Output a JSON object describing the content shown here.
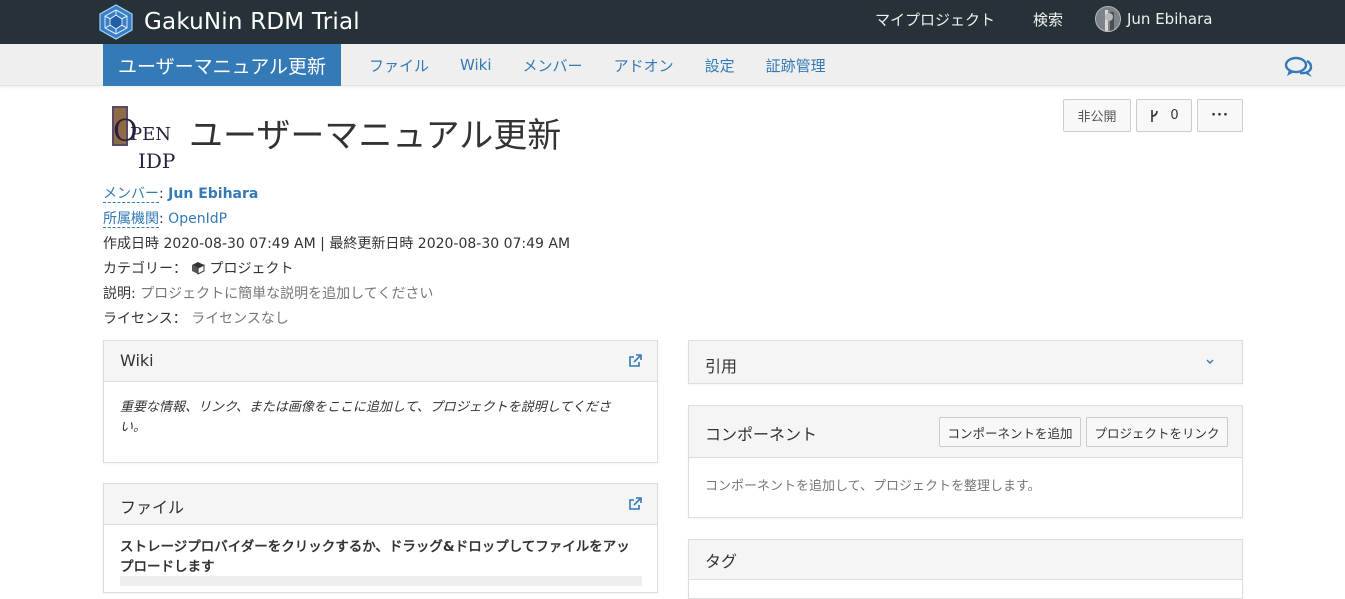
{
  "topbar": {
    "brand": "GakuNin RDM Trial",
    "my_projects": "マイプロジェクト",
    "search": "検索",
    "user_name": "Jun Ebihara"
  },
  "project_nav": {
    "title": "ユーザーマニュアル更新",
    "tabs": [
      "ファイル",
      "Wiki",
      "メンバー",
      "アドオン",
      "設定",
      "証跡管理"
    ]
  },
  "header": {
    "logo_line1": "OPEN",
    "logo_line2": "IDP",
    "title": "ユーザーマニュアル更新",
    "private_label": "非公開",
    "fork_count": "0",
    "more_label": "···"
  },
  "meta": {
    "members_label": "メンバー",
    "members_value": "Jun Ebihara",
    "affiliation_label": "所属機関",
    "affiliation_value": "OpenIdP",
    "dates": "作成日時 2020-08-30 07:49 AM | 最終更新日時 2020-08-30 07:49 AM",
    "category_label": "カテゴリー：",
    "category_value": "プロジェクト",
    "description_label": "説明:",
    "description_value": "プロジェクトに簡単な説明を追加してください",
    "license_label": "ライセンス：",
    "license_value": "ライセンスなし"
  },
  "wiki_panel": {
    "title": "Wiki",
    "body": "重要な情報、リンク、または画像をここに追加して、プロジェクトを説明してください。"
  },
  "files_panel": {
    "title": "ファイル",
    "body": "ストレージプロバイダーをクリックするか、ドラッグ&ドロップしてファイルをアップロードします"
  },
  "citation_panel": {
    "title": "引用"
  },
  "components_panel": {
    "title": "コンポーネント",
    "add_button": "コンポーネントを追加",
    "link_button": "プロジェクトをリンク",
    "body": "コンポーネントを追加して、プロジェクトを整理します。"
  },
  "tags_panel": {
    "title": "タグ"
  },
  "colors": {
    "topbar": "#263238",
    "accent": "#337ab7",
    "projbar": "#efefef"
  }
}
